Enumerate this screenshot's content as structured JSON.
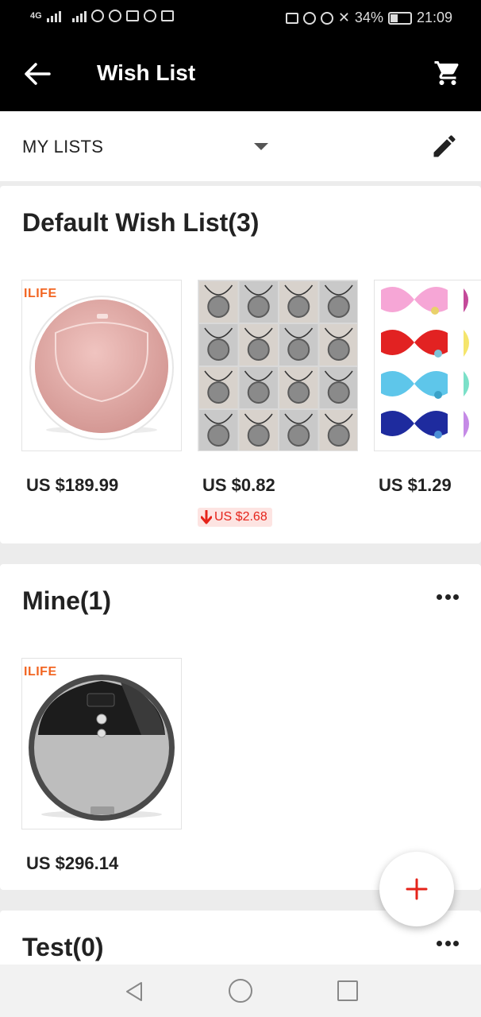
{
  "status_bar": {
    "network": "4G",
    "battery": "34%",
    "time": "21:09"
  },
  "app_bar": {
    "title": "Wish List",
    "back_icon": "arrow-left-icon",
    "cart_icon": "cart-icon"
  },
  "lists_bar": {
    "label": "MY LISTS",
    "dropdown_icon": "caret-down-icon",
    "edit_icon": "pencil-icon"
  },
  "lists": [
    {
      "title": "Default Wish List(3)",
      "products": [
        {
          "name": "ILIFE robot vacuum (pink)",
          "brand": "ILIFE",
          "price": "US $189.99"
        },
        {
          "name": "Silver pendant necklaces set",
          "price": "US $0.82",
          "price_drop": "US $2.68"
        },
        {
          "name": "Pet bow tie collars",
          "price": "US $1.29"
        }
      ]
    },
    {
      "title": "Mine(1)",
      "products": [
        {
          "name": "ILIFE robot vacuum (silver)",
          "brand": "ILIFE",
          "price": "US $296.14"
        }
      ]
    },
    {
      "title": "Test(0)",
      "products": []
    }
  ],
  "fab": {
    "icon": "plus-icon"
  },
  "colors": {
    "accent": "#e5231a",
    "appbar": "#000000",
    "brand_orange": "#f26522"
  }
}
